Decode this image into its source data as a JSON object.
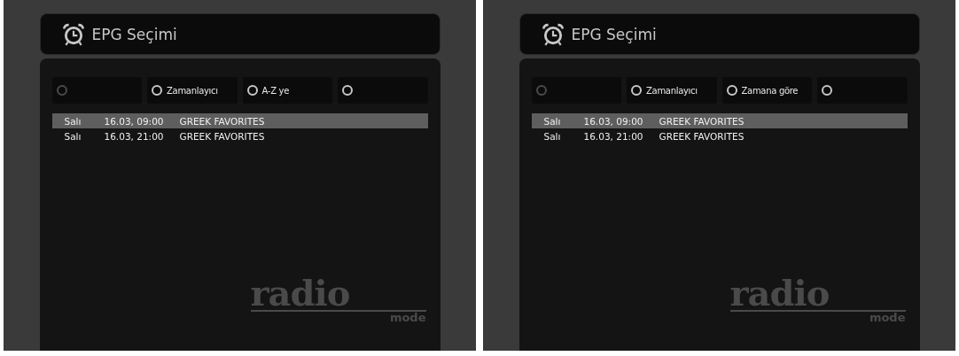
{
  "screens": [
    {
      "title": "EPG Seçimi",
      "buttons": [
        {
          "dimmed": true
        },
        {
          "label": "Zamanlayıcı",
          "dimmed": false
        },
        {
          "label": "A-Z ye",
          "dimmed": false
        },
        {
          "dimmed": false
        }
      ],
      "rows": [
        {
          "day": "Salı",
          "date": "16.03, 09:00",
          "title": "GREEK FAVORITES",
          "selected": true
        },
        {
          "day": "Salı",
          "date": "16.03, 21:00",
          "title": "GREEK FAVORITES",
          "selected": false
        }
      ],
      "logo": {
        "word": "radio",
        "sub": "mode"
      }
    },
    {
      "title": "EPG Seçimi",
      "buttons": [
        {
          "dimmed": true
        },
        {
          "label": "Zamanlayıcı",
          "dimmed": false
        },
        {
          "label": "Zamana göre",
          "dimmed": false
        },
        {
          "dimmed": false
        }
      ],
      "rows": [
        {
          "day": "Salı",
          "date": "16.03, 09:00",
          "title": "GREEK FAVORITES",
          "selected": true
        },
        {
          "day": "Salı",
          "date": "16.03, 21:00",
          "title": "GREEK FAVORITES",
          "selected": false
        }
      ],
      "logo": {
        "word": "radio",
        "sub": "mode"
      }
    }
  ]
}
